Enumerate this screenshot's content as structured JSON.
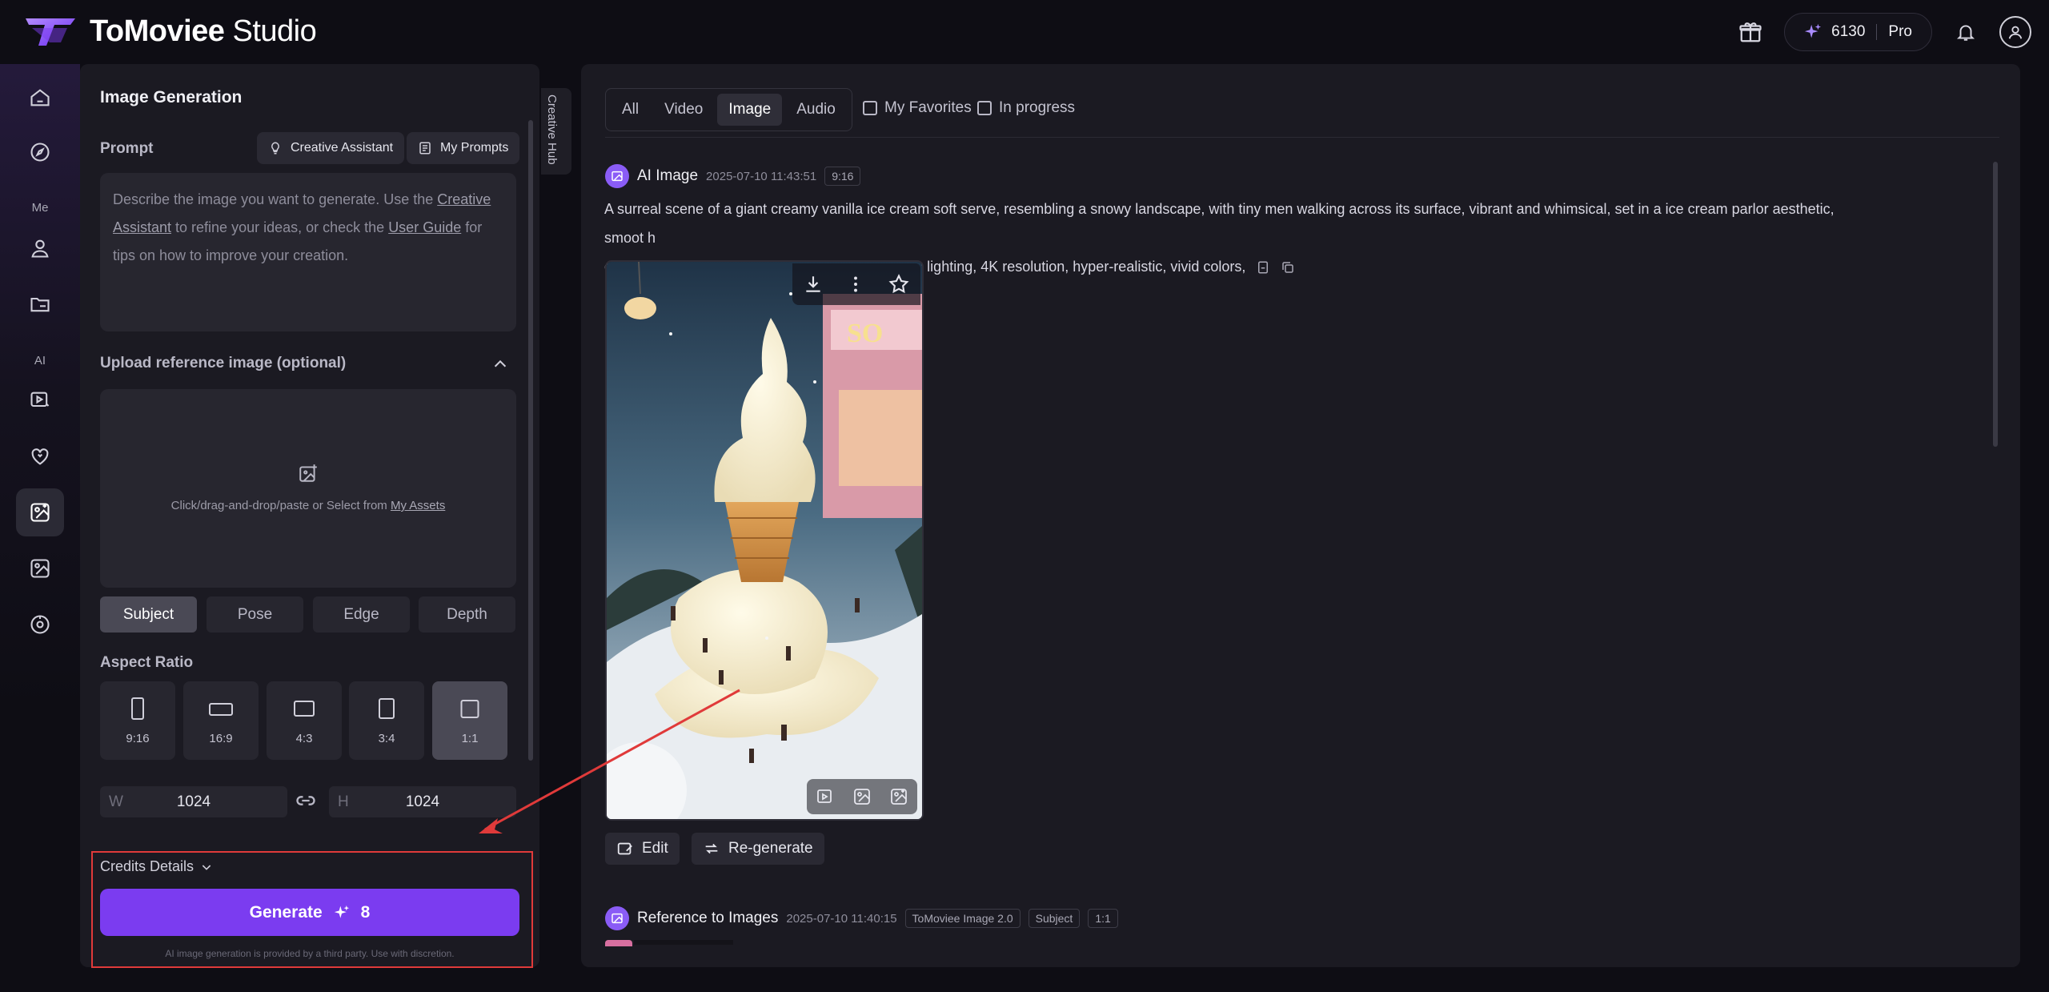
{
  "app": {
    "brand_bold": "ToMoviee",
    "brand_light": "Studio"
  },
  "topbar": {
    "credits": "6130",
    "plan": "Pro"
  },
  "nav": {
    "section_me": "Me",
    "section_ai": "AI"
  },
  "panel": {
    "title": "Image Generation",
    "prompt_label": "Prompt",
    "creative_assistant_label": "Creative Assistant",
    "my_prompts_label": "My Prompts",
    "prompt_placeholder_1": "Describe the image you want to generate. Use the ",
    "prompt_link_1": "Creative Assistant",
    "prompt_placeholder_2": " to refine your ideas, or check the ",
    "prompt_link_2": "User Guide",
    "prompt_placeholder_3": " for tips on how to improve your creation.",
    "upload_label": "Upload reference image (optional)",
    "upload_text": "Click/drag-and-drop/paste or Select from ",
    "upload_link": "My Assets",
    "ref_modes": [
      "Subject",
      "Pose",
      "Edge",
      "Depth"
    ],
    "ref_mode_selected": "Subject",
    "aspect_label": "Aspect Ratio",
    "aspect_ratios": [
      "9:16",
      "16:9",
      "4:3",
      "3:4",
      "1:1"
    ],
    "aspect_selected": "1:1",
    "width_prefix": "W",
    "width_value": "1024",
    "height_prefix": "H",
    "height_value": "1024",
    "credits_details": "Credits Details",
    "generate_label": "Generate",
    "generate_cost": "8",
    "disclaimer": "AI image generation is provided by a third party. Use with discretion."
  },
  "hub_tab": "Creative Hub",
  "content": {
    "filters": [
      "All",
      "Video",
      "Image",
      "Audio"
    ],
    "filter_selected": "Image",
    "my_favorites": "My Favorites",
    "in_progress": "In progress",
    "entry1": {
      "title": "AI Image",
      "date": "2025-07-10 11:43:51",
      "tag": "9:16",
      "prompt_line1": "A surreal scene of a giant creamy vanilla ice cream soft serve, resembling a snowy landscape, with tiny men walking across its surface, vibrant and whimsical, set in a ice cream parlor aesthetic, smoot h",
      "prompt_line2": "creamy texture, playful and imaginative, cinematic lighting, 4K resolution, hyper-realistic, vivid colors,",
      "edit_label": "Edit",
      "regenerate_label": "Re-generate"
    },
    "entry2": {
      "title": "Reference to Images",
      "date": "2025-07-10 11:40:15",
      "tags": [
        "ToMoviee Image 2.0",
        "Subject",
        "1:1"
      ]
    }
  },
  "colors": {
    "accent": "#7b3cf0",
    "annotation": "#e03a3a"
  }
}
